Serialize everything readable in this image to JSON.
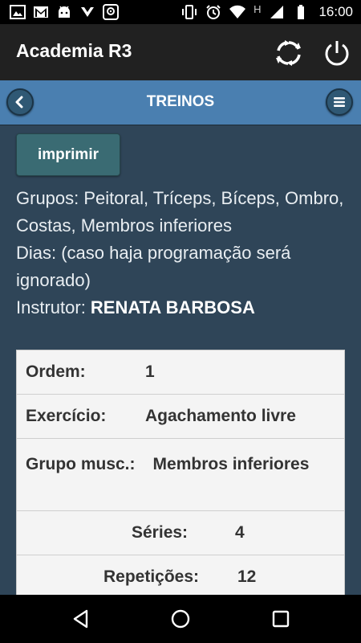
{
  "status_bar": {
    "time": "16:00",
    "network_letter": "H",
    "icons": [
      "image-icon",
      "gmail-icon",
      "android-icon",
      "check-icon",
      "location-icon",
      "vibrate-icon",
      "alarm-icon",
      "wifi-icon",
      "signal-icon",
      "battery-icon"
    ]
  },
  "app_bar": {
    "title": "Academia R3",
    "sync_icon": "sync-icon",
    "power_icon": "power-icon"
  },
  "header": {
    "title": "TREINOS",
    "back_icon": "chevron-left-icon",
    "menu_icon": "hamburger-menu-icon"
  },
  "content": {
    "print_label": "imprimir",
    "groups_text": "Grupos: Peitoral, Tríceps, Bíceps, Ombro, Costas, Membros inferiores",
    "days_text": "Dias: (caso haja programação será ignorado)",
    "instructor_label": "Instrutor: ",
    "instructor_name": "RENATA BARBOSA"
  },
  "exercise_card": {
    "order_label": "Ordem:",
    "order_value": "1",
    "exercise_label": "Exercício:",
    "exercise_value": "Agachamento livre",
    "muscle_group_label": "Grupo musc.:",
    "muscle_group_value": "Membros inferiores",
    "series_label": "Séries:",
    "series_value": "4",
    "reps_label": "Repetições:",
    "reps_value": "12"
  },
  "colors": {
    "background": "#2f4558",
    "header": "#4a7fb0",
    "app_bar": "#212121",
    "print_button": "#3a6b73",
    "card": "#f4f4f4"
  }
}
